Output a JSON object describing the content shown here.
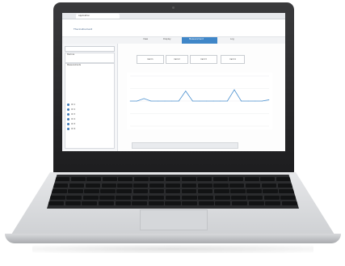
{
  "browser": {
    "tab_title": "Application",
    "url": ""
  },
  "app": {
    "title": "The Instrument",
    "accent_color": "#3f86c8"
  },
  "toolbar": {
    "items": [
      "View",
      "Display",
      "Measurement",
      "Log"
    ],
    "active_index": 2
  },
  "sidebar": {
    "section_one": "Devices",
    "section_two": "Measurements",
    "channels": [
      "Ch 1",
      "Ch 2",
      "Ch 3",
      "Ch 4",
      "Ch 5",
      "Ch 6"
    ]
  },
  "cards": [
    "Card 1",
    "Card 2",
    "Card 3",
    "Card 4"
  ],
  "chart_data": {
    "type": "line",
    "x": [
      0,
      1,
      2,
      3,
      4,
      5,
      6,
      7,
      8,
      9,
      10,
      11,
      12,
      13,
      14,
      15,
      16,
      17,
      18,
      19,
      20
    ],
    "series": [
      {
        "values": [
          20,
          20,
          22,
          20,
          20,
          20,
          20,
          20,
          28,
          20,
          20,
          20,
          20,
          20,
          20,
          29,
          20,
          20,
          20,
          20,
          21
        ]
      }
    ],
    "xlabel": "",
    "ylabel": "",
    "ylim": [
      0,
      40
    ],
    "grid": true
  },
  "icons": {
    "camera": "camera-icon"
  }
}
